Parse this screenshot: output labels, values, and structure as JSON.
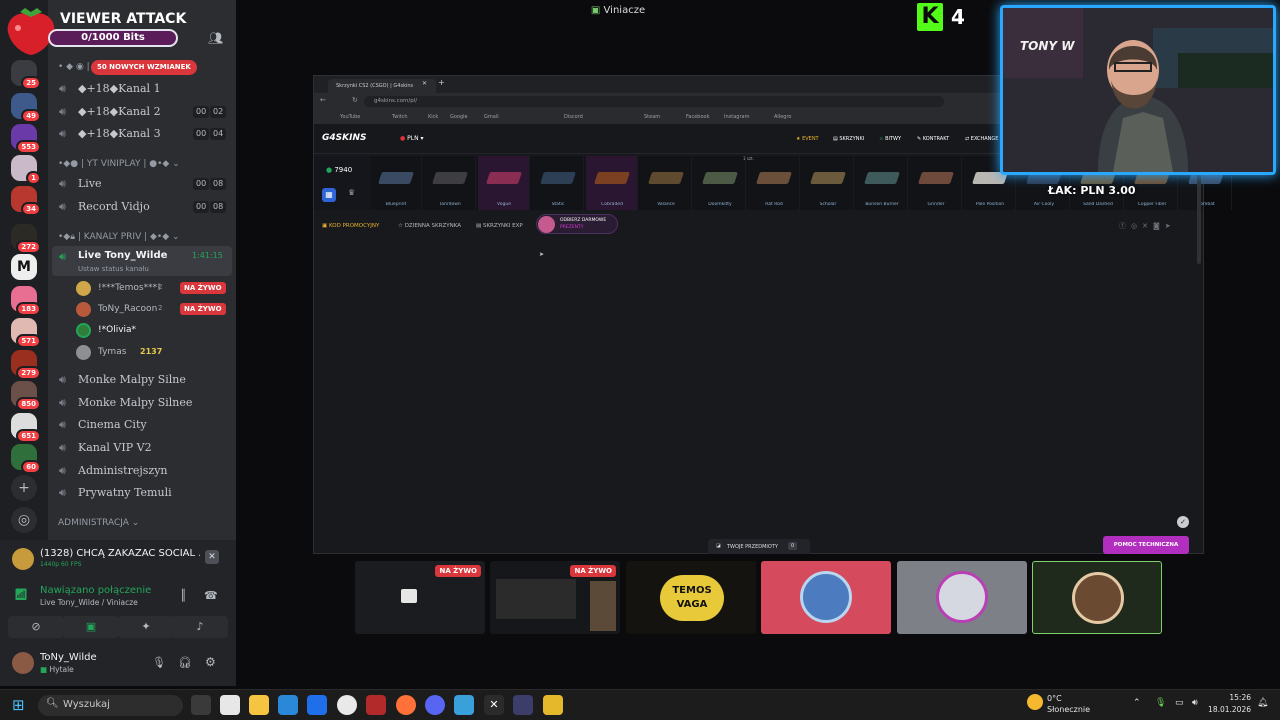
{
  "overlay": {
    "title": "VIEWER ATTACK",
    "bits": "0/1000 Bits",
    "k_label": "K",
    "k_count": "4",
    "webcam_text": "TONY W",
    "price_ticker": "ŁAK: PLN 3.00"
  },
  "window_title": "Viniacze",
  "servers": [
    {
      "badge": "25"
    },
    {
      "badge": "49"
    },
    {
      "badge": "553"
    },
    {
      "badge": "1"
    },
    {
      "badge": "34"
    },
    {
      "badge": "272"
    },
    {
      "badge": ""
    },
    {
      "badge": "183"
    },
    {
      "badge": "571"
    },
    {
      "badge": "279"
    },
    {
      "badge": "850"
    },
    {
      "badge": "651"
    },
    {
      "badge": "60"
    }
  ],
  "discord": {
    "mentions_banner": "50 NOWYCH WZMIANEK",
    "channels_top": [
      {
        "name": "◆+18◆Kanal 1",
        "pill1": "",
        "pill2": ""
      },
      {
        "name": "◆+18◆Kanal 2",
        "pill1": "00",
        "pill2": "02"
      },
      {
        "name": "◆+18◆Kanal 3",
        "pill1": "00",
        "pill2": "04"
      }
    ],
    "category_yt": "YT VINIPLAY",
    "channels_yt": [
      {
        "name": "Live",
        "pill1": "00",
        "pill2": "08"
      },
      {
        "name": "Record Vidjo",
        "pill1": "00",
        "pill2": "08"
      }
    ],
    "category_priv": "KANALY PRIV",
    "live_channel": {
      "name": "Live Tony_Wilde",
      "time": "1:41:15",
      "status": "Ustaw status kanału"
    },
    "live_users": [
      {
        "name": "!***Temos***!",
        "extra": "2",
        "live": "NA ŻYWO"
      },
      {
        "name": "ToNy_Racoon",
        "extra": "2",
        "live": "NA ŻYWO"
      },
      {
        "name": "!*Olivia*",
        "extra": "",
        "live": ""
      },
      {
        "name": "Tymas",
        "extra": "2137",
        "live": ""
      }
    ],
    "channels_more": [
      {
        "name": "Monke Malpy Silne"
      },
      {
        "name": "Monke Malpy Silnee"
      },
      {
        "name": "Cinema City"
      },
      {
        "name": "Kanal VIP V2"
      },
      {
        "name": "Administrejszyn"
      },
      {
        "name": "Prywatny Temuli"
      }
    ],
    "category_admin": "ADMINISTRACJA",
    "now_playing": "(1328) CHCĄ ZAKAZAĆ SOCIAL ...",
    "now_playing_quality": "1440p 60 FPS",
    "voice_status": "Nawiązano połączenie",
    "voice_channel": "Live Tony_Wilde",
    "voice_server": "Viniacze",
    "user_name": "ToNy_Wilde",
    "user_status": "Hytale"
  },
  "browser": {
    "tab_title": "Skrzynki CS2 (CSGO) | G4skins",
    "url": "g4skins.com/pl/",
    "bookmarks": [
      "YouTube",
      "Twitch",
      "Kick",
      "Google",
      "Gmail",
      "Discord",
      "Instagram",
      "Facebook",
      "Steam",
      "Allegro"
    ],
    "site": {
      "logo": "G4SKINS",
      "currency": "PLN",
      "nav": [
        "EVENT",
        "SKRZYNKI",
        "BITWY",
        "KONTRAKT",
        "EXCHANGE"
      ],
      "online_count": "7940",
      "skins": [
        "Blueprint",
        "Tanrdown",
        "Vogue",
        "Static",
        "Cobraded",
        "Valance",
        "Doomkitty",
        "Rat Rod",
        "Scholar",
        "Bunsen Burner",
        "Grinder",
        "Pale Position",
        "Air Cooly",
        "Sand Dashed",
        "Copper Fiber",
        "Combat"
      ],
      "skin_note": "1 szt.",
      "subnav": [
        "KOD PROMOCYJNY",
        "DZIENNA SKRZYNKA",
        "SKRZYNKI EXP"
      ],
      "free_gifts": "ODBIERZ DARMOWE",
      "free_gifts_sub": "PREZENTY",
      "items_label": "TWOJE PRZEDMIOTY",
      "items_count": "0",
      "support_label": "POMOC TECHNICZNA"
    }
  },
  "tiles": [
    {
      "live": "NA ŻYWO",
      "bg": "#1a1c20"
    },
    {
      "live": "NA ŻYWO",
      "bg": "#16171b"
    },
    {
      "live": "",
      "text": "TEMOS VAGA",
      "bg": "#14130f"
    },
    {
      "live": "",
      "bg": "#d54a5c"
    },
    {
      "live": "",
      "bg": "#7d8087"
    },
    {
      "live": "",
      "bg": "#1f2a1d"
    }
  ],
  "taskbar": {
    "search_placeholder": "Wyszukaj",
    "weather_temp": "0°C",
    "weather_desc": "Słonecznie",
    "time": "15:26",
    "date": "18.01.2026"
  },
  "colors": {
    "discord_bg": "#2b2d31",
    "live_red": "#da373c",
    "accent_pink": "#d63ad0",
    "green": "#23a55a",
    "site_yellow": "#e7b12c"
  }
}
